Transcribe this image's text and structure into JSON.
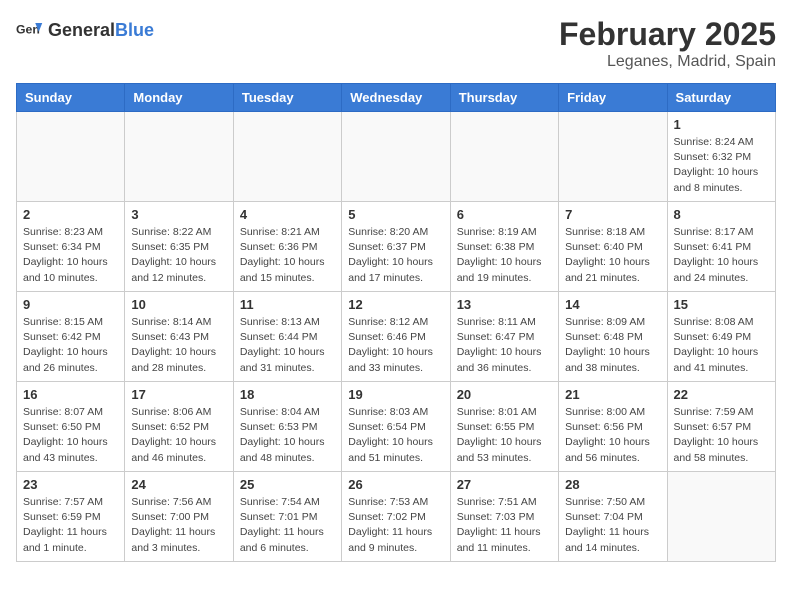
{
  "header": {
    "logo_general": "General",
    "logo_blue": "Blue",
    "month": "February 2025",
    "location": "Leganes, Madrid, Spain"
  },
  "weekdays": [
    "Sunday",
    "Monday",
    "Tuesday",
    "Wednesday",
    "Thursday",
    "Friday",
    "Saturday"
  ],
  "weeks": [
    [
      {
        "day": "",
        "info": ""
      },
      {
        "day": "",
        "info": ""
      },
      {
        "day": "",
        "info": ""
      },
      {
        "day": "",
        "info": ""
      },
      {
        "day": "",
        "info": ""
      },
      {
        "day": "",
        "info": ""
      },
      {
        "day": "1",
        "info": "Sunrise: 8:24 AM\nSunset: 6:32 PM\nDaylight: 10 hours and 8 minutes."
      }
    ],
    [
      {
        "day": "2",
        "info": "Sunrise: 8:23 AM\nSunset: 6:34 PM\nDaylight: 10 hours and 10 minutes."
      },
      {
        "day": "3",
        "info": "Sunrise: 8:22 AM\nSunset: 6:35 PM\nDaylight: 10 hours and 12 minutes."
      },
      {
        "day": "4",
        "info": "Sunrise: 8:21 AM\nSunset: 6:36 PM\nDaylight: 10 hours and 15 minutes."
      },
      {
        "day": "5",
        "info": "Sunrise: 8:20 AM\nSunset: 6:37 PM\nDaylight: 10 hours and 17 minutes."
      },
      {
        "day": "6",
        "info": "Sunrise: 8:19 AM\nSunset: 6:38 PM\nDaylight: 10 hours and 19 minutes."
      },
      {
        "day": "7",
        "info": "Sunrise: 8:18 AM\nSunset: 6:40 PM\nDaylight: 10 hours and 21 minutes."
      },
      {
        "day": "8",
        "info": "Sunrise: 8:17 AM\nSunset: 6:41 PM\nDaylight: 10 hours and 24 minutes."
      }
    ],
    [
      {
        "day": "9",
        "info": "Sunrise: 8:15 AM\nSunset: 6:42 PM\nDaylight: 10 hours and 26 minutes."
      },
      {
        "day": "10",
        "info": "Sunrise: 8:14 AM\nSunset: 6:43 PM\nDaylight: 10 hours and 28 minutes."
      },
      {
        "day": "11",
        "info": "Sunrise: 8:13 AM\nSunset: 6:44 PM\nDaylight: 10 hours and 31 minutes."
      },
      {
        "day": "12",
        "info": "Sunrise: 8:12 AM\nSunset: 6:46 PM\nDaylight: 10 hours and 33 minutes."
      },
      {
        "day": "13",
        "info": "Sunrise: 8:11 AM\nSunset: 6:47 PM\nDaylight: 10 hours and 36 minutes."
      },
      {
        "day": "14",
        "info": "Sunrise: 8:09 AM\nSunset: 6:48 PM\nDaylight: 10 hours and 38 minutes."
      },
      {
        "day": "15",
        "info": "Sunrise: 8:08 AM\nSunset: 6:49 PM\nDaylight: 10 hours and 41 minutes."
      }
    ],
    [
      {
        "day": "16",
        "info": "Sunrise: 8:07 AM\nSunset: 6:50 PM\nDaylight: 10 hours and 43 minutes."
      },
      {
        "day": "17",
        "info": "Sunrise: 8:06 AM\nSunset: 6:52 PM\nDaylight: 10 hours and 46 minutes."
      },
      {
        "day": "18",
        "info": "Sunrise: 8:04 AM\nSunset: 6:53 PM\nDaylight: 10 hours and 48 minutes."
      },
      {
        "day": "19",
        "info": "Sunrise: 8:03 AM\nSunset: 6:54 PM\nDaylight: 10 hours and 51 minutes."
      },
      {
        "day": "20",
        "info": "Sunrise: 8:01 AM\nSunset: 6:55 PM\nDaylight: 10 hours and 53 minutes."
      },
      {
        "day": "21",
        "info": "Sunrise: 8:00 AM\nSunset: 6:56 PM\nDaylight: 10 hours and 56 minutes."
      },
      {
        "day": "22",
        "info": "Sunrise: 7:59 AM\nSunset: 6:57 PM\nDaylight: 10 hours and 58 minutes."
      }
    ],
    [
      {
        "day": "23",
        "info": "Sunrise: 7:57 AM\nSunset: 6:59 PM\nDaylight: 11 hours and 1 minute."
      },
      {
        "day": "24",
        "info": "Sunrise: 7:56 AM\nSunset: 7:00 PM\nDaylight: 11 hours and 3 minutes."
      },
      {
        "day": "25",
        "info": "Sunrise: 7:54 AM\nSunset: 7:01 PM\nDaylight: 11 hours and 6 minutes."
      },
      {
        "day": "26",
        "info": "Sunrise: 7:53 AM\nSunset: 7:02 PM\nDaylight: 11 hours and 9 minutes."
      },
      {
        "day": "27",
        "info": "Sunrise: 7:51 AM\nSunset: 7:03 PM\nDaylight: 11 hours and 11 minutes."
      },
      {
        "day": "28",
        "info": "Sunrise: 7:50 AM\nSunset: 7:04 PM\nDaylight: 11 hours and 14 minutes."
      },
      {
        "day": "",
        "info": ""
      }
    ]
  ]
}
